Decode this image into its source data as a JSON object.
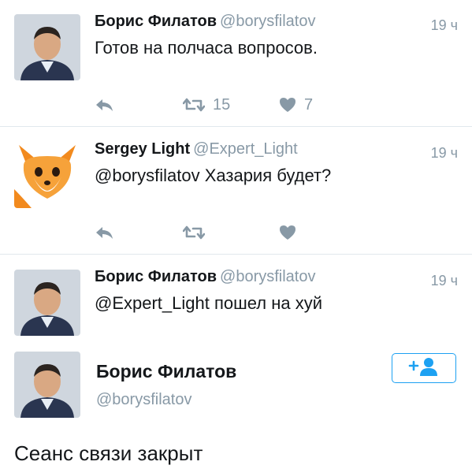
{
  "tweets": [
    {
      "name": "Борис Филатов",
      "handle": "@borysfilatov",
      "time": "19 ч",
      "text": "Готов на полчаса вопросов.",
      "retweets": "15",
      "likes": "7",
      "avatar": "man-photo"
    },
    {
      "name": "Sergey Light",
      "handle": "@Expert_Light",
      "time": "19 ч",
      "text": "@borysfilatov Хазария будет?",
      "retweets": "",
      "likes": "",
      "avatar": "fox-cartoon"
    },
    {
      "name": "Борис Филатов",
      "handle": "@borysfilatov",
      "time": "19 ч",
      "text": "@Expert_Light пошел на хуй",
      "retweets": "",
      "likes": "",
      "avatar": "man-photo"
    }
  ],
  "profile": {
    "name": "Борис Филатов",
    "handle": "@borysfilatov",
    "follow_icon": "add-user-icon"
  },
  "closing_text": "Сеанс связи закрыт",
  "colors": {
    "accent": "#1da1f2",
    "muted": "#8899a6",
    "divider": "#e1e8ed"
  }
}
